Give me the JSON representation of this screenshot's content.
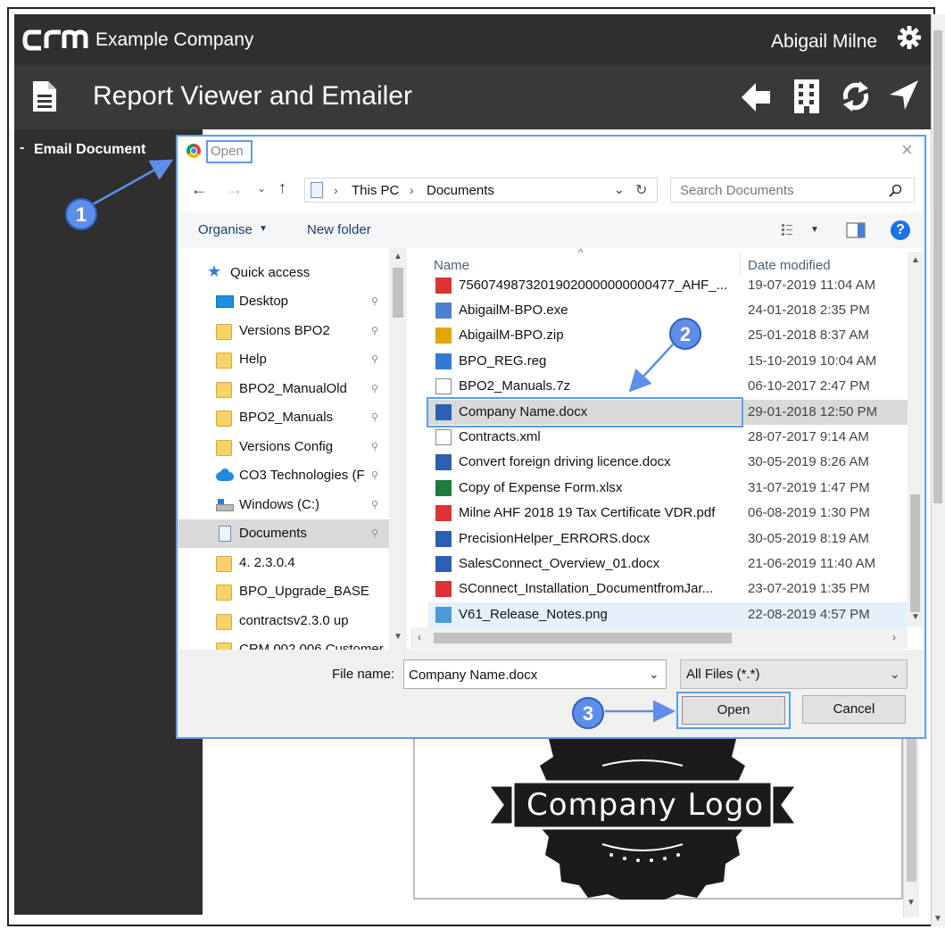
{
  "app": {
    "company": "Example Company",
    "user": "Abigail Milne",
    "page_title": "Report Viewer and Emailer",
    "sidebar_item": "Email Document",
    "logo_text": "Company Logo"
  },
  "dialog": {
    "title": "Open",
    "breadcrumb": [
      "This PC",
      "Documents"
    ],
    "search_placeholder": "Search Documents",
    "toolbar": {
      "organise": "Organise",
      "new_folder": "New folder"
    },
    "nav": [
      {
        "label": "Quick access",
        "icon": "star-icon"
      },
      {
        "label": "Desktop",
        "icon": "desktop-icon"
      },
      {
        "label": "Versions BPO2",
        "icon": "folder-icon"
      },
      {
        "label": "Help",
        "icon": "folder-icon"
      },
      {
        "label": "BPO2_ManualOld",
        "icon": "folder-icon"
      },
      {
        "label": "BPO2_Manuals",
        "icon": "folder-icon"
      },
      {
        "label": "Versions Config",
        "icon": "folder-icon"
      },
      {
        "label": "CO3 Technologies (F",
        "icon": "cloud-icon"
      },
      {
        "label": "Windows (C:)",
        "icon": "drive-icon"
      },
      {
        "label": "Documents",
        "icon": "documents-icon"
      },
      {
        "label": "4. 2.3.0.4",
        "icon": "folder-icon"
      },
      {
        "label": "BPO_Upgrade_BASE",
        "icon": "folder-icon"
      },
      {
        "label": "contractsv2.3.0 up",
        "icon": "folder-icon"
      },
      {
        "label": "CRM 002 006 Customer",
        "icon": "folder-icon"
      }
    ],
    "columns": {
      "name": "Name",
      "date": "Date modified"
    },
    "files": [
      {
        "name": "75607498732019020000000000477_AHF_...",
        "date": "19-07-2019 11:04 AM",
        "type": "pdf"
      },
      {
        "name": "AbigailM-BPO.exe",
        "date": "24-01-2018 2:35 PM",
        "type": "exe"
      },
      {
        "name": "AbigailM-BPO.zip",
        "date": "25-01-2018 8:37 AM",
        "type": "zip"
      },
      {
        "name": "BPO_REG.reg",
        "date": "15-10-2019 10:04 AM",
        "type": "reg"
      },
      {
        "name": "BPO2_Manuals.7z",
        "date": "06-10-2017 2:47 PM",
        "type": "file"
      },
      {
        "name": "Company Name.docx",
        "date": "29-01-2018 12:50 PM",
        "type": "docx"
      },
      {
        "name": "Contracts.xml",
        "date": "28-07-2017 9:14 AM",
        "type": "file"
      },
      {
        "name": "Convert foreign driving licence.docx",
        "date": "30-05-2019 8:26 AM",
        "type": "docx"
      },
      {
        "name": "Copy of Expense Form.xlsx",
        "date": "31-07-2019 1:47 PM",
        "type": "xlsx"
      },
      {
        "name": "Milne AHF 2018 19 Tax Certificate VDR.pdf",
        "date": "06-08-2019 1:30 PM",
        "type": "pdf"
      },
      {
        "name": "PrecisionHelper_ERRORS.docx",
        "date": "30-05-2019 8:19 AM",
        "type": "docx"
      },
      {
        "name": "SalesConnect_Overview_01.docx",
        "date": "21-06-2019 11:40 AM",
        "type": "docx"
      },
      {
        "name": "SConnect_Installation_DocumentfromJar...",
        "date": "23-07-2019 1:35 PM",
        "type": "pdf"
      },
      {
        "name": "V61_Release_Notes.png",
        "date": "22-08-2019 4:57 PM",
        "type": "png"
      }
    ],
    "file_name_label": "File name:",
    "file_name_value": "Company Name.docx",
    "file_type_value": "All Files (*.*)",
    "open_button": "Open",
    "cancel_button": "Cancel"
  },
  "callouts": [
    "1",
    "2",
    "3"
  ],
  "colors": {
    "accent": "#5a9cf0",
    "callout": "#5e8ee8",
    "app_bg": "#2f2f2f"
  }
}
